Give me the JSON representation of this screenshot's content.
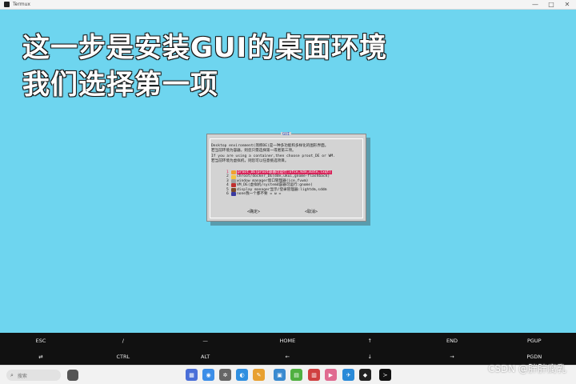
{
  "window": {
    "title": "Termux",
    "minimize": "—",
    "maximize": "□",
    "close": "✕"
  },
  "caption": {
    "line1": "这一步是安装GUI的桌面环境",
    "line2": "我们选择第一项"
  },
  "dialog": {
    "title": "GUI",
    "intro": [
      "Desktop environment(简称DE)是一种多功能和多样化的图形界面。",
      "若当前环境为容器，则您只需选择第一或者第三项。",
      "If you are using a container,then choose proot_DE or WM.",
      "若当前环境为虚拟机，则您可以任意挑选项目。"
    ],
    "options": [
      {
        "num": "1",
        "label": "proot_DE(proot容器可运行:xfce,kde,mate,lxqt)",
        "selected": true,
        "icon_color": "#f0a030"
      },
      {
        "num": "2",
        "label": "chroot/docker_DE(dde,ukui,gnome-flashback)",
        "selected": false,
        "icon_color": "#f3c440"
      },
      {
        "num": "3",
        "label": "window manager窗口管理器(ice,fvwm)",
        "selected": false,
        "icon_color": "#a0a0a0"
      },
      {
        "num": "4",
        "label": "VM_DE(虚拟机/systemd容器可运行:gnome)",
        "selected": false,
        "icon_color": "#c03030"
      },
      {
        "num": "5",
        "label": "display manager显示/登录管理器:lightdm,sddm",
        "selected": false,
        "icon_color": "#7a4a2a"
      },
      {
        "num": "6",
        "label": "none我一个都不要 =  ω  =",
        "selected": false,
        "icon_color": "#3a3aa0"
      }
    ],
    "ok_label": "<确定>",
    "cancel_label": "<取消>"
  },
  "extra_keys": {
    "row1": [
      "ESC",
      "/",
      "—",
      "HOME",
      "↑",
      "END",
      "PGUP"
    ],
    "row2": [
      "⇄",
      "CTRL",
      "ALT",
      "←",
      "↓",
      "→",
      "PGDN"
    ]
  },
  "taskbar": {
    "search_placeholder": "搜索",
    "search_icon": "magnifier-icon"
  },
  "watermark": "CSDN @胖胖腐乳",
  "colors": {
    "terminal_bg": "#6ed5ef",
    "highlight": "#d8245a",
    "keys_bg": "#111111"
  }
}
